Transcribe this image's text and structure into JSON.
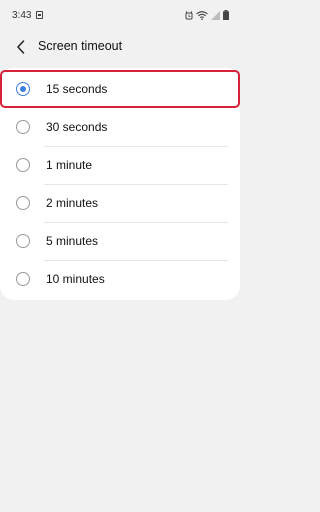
{
  "status_bar": {
    "time": "3:43",
    "icons": [
      "notification-icon",
      "alarm-icon",
      "wifi-icon",
      "signal-icon",
      "battery-icon"
    ]
  },
  "header": {
    "back_icon": "back-arrow-icon",
    "title": "Screen timeout"
  },
  "options": [
    {
      "label": "15 seconds",
      "selected": true
    },
    {
      "label": "30 seconds",
      "selected": false
    },
    {
      "label": "1 minute",
      "selected": false
    },
    {
      "label": "2 minutes",
      "selected": false
    },
    {
      "label": "5 minutes",
      "selected": false
    },
    {
      "label": "10 minutes",
      "selected": false
    }
  ],
  "colors": {
    "accent": "#3e7ee0",
    "highlight_border": "#d6233a",
    "background": "#f1f1f1",
    "card": "#ffffff"
  }
}
